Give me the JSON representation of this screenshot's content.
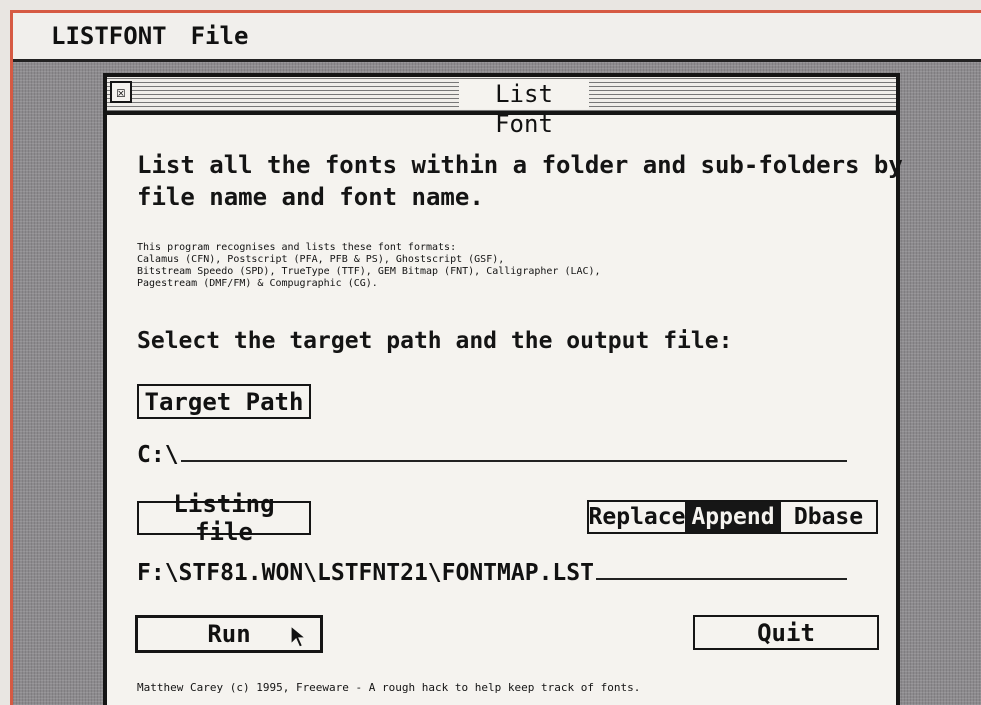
{
  "menubar": {
    "app_menu": "LISTFONT",
    "file_menu": "File"
  },
  "dialog": {
    "title": "List Font",
    "close_glyph": "☒",
    "heading": "List all the fonts within a folder and sub-folders by\nfile name and font name.",
    "formats_note": "This program recognises and lists these font formats:\nCalamus (CFN), Postscript (PFA, PFB & PS), Ghostscript (GSF),\nBitstream Speedo (SPD), TrueType (TTF), GEM Bitmap (FNT), Calligrapher (LAC),\nPagestream (DMF/FM) & Compugraphic (CG).",
    "select_prompt": "Select the target path and the output file:",
    "target_path_button": "Target Path",
    "target_path_value": "C:\\",
    "listing_file_button": "Listing file",
    "listing_file_value": "F:\\STF81.WON\\LSTFNT21\\FONTMAP.LST",
    "mode": {
      "options": [
        "Replace",
        "Append",
        "Dbase"
      ],
      "selected": "Append"
    },
    "run_button": "Run",
    "quit_button": "Quit",
    "footer": "Matthew Carey (c) 1995, Freeware - A rough hack to help keep track of fonts."
  },
  "icons": {
    "close": "close-box-icon",
    "cursor": "mouse-pointer-icon"
  },
  "colors": {
    "desktop": "#8d8b8e",
    "window": "#f5f3ef",
    "ink": "#151515",
    "border_accent": "#d65a43"
  }
}
